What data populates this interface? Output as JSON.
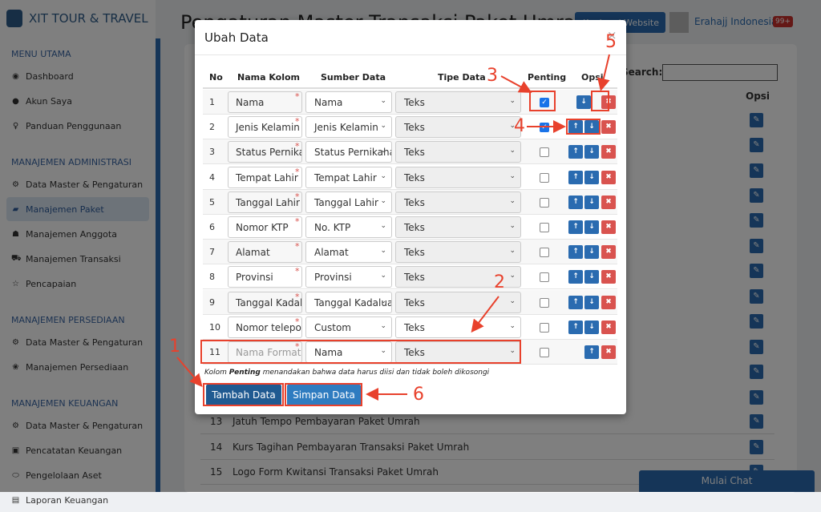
{
  "app": {
    "brand": "XIT TOUR & TRAVEL",
    "page_title": "Pengaturan Master Transaksi Paket Umrah",
    "website_button": "Kunjungi Website",
    "user_name": "Erahajj Indonesia",
    "notif_badge": "99+"
  },
  "sidebar": {
    "sections": [
      {
        "title": "MENU UTAMA",
        "items": [
          {
            "label": "Dashboard",
            "icon": "globe-icon"
          },
          {
            "label": "Akun Saya",
            "icon": "user-icon"
          },
          {
            "label": "Panduan Penggunaan",
            "icon": "lightbulb-icon"
          }
        ]
      },
      {
        "title": "MANAJEMEN ADMINISTRASI",
        "items": [
          {
            "label": "Data Master & Pengaturan",
            "icon": "cogs-icon"
          },
          {
            "label": "Manajemen Paket",
            "icon": "book-icon",
            "active": true
          },
          {
            "label": "Manajemen Anggota",
            "icon": "users-icon"
          },
          {
            "label": "Manajemen Transaksi",
            "icon": "cart-icon"
          },
          {
            "label": "Pencapaian",
            "icon": "star-icon"
          }
        ]
      },
      {
        "title": "MANAJEMEN PERSEDIAAN",
        "items": [
          {
            "label": "Data Master & Pengaturan",
            "icon": "cogs-icon"
          },
          {
            "label": "Manajemen Persediaan",
            "icon": "cubes-icon"
          }
        ]
      },
      {
        "title": "MANAJEMEN KEUANGAN",
        "items": [
          {
            "label": "Data Master & Pengaturan",
            "icon": "cogs-icon"
          },
          {
            "label": "Pencatatan Keuangan",
            "icon": "money-icon"
          },
          {
            "label": "Pengelolaan Aset",
            "icon": "hdd-icon"
          },
          {
            "label": "Laporan Keuangan",
            "icon": "report-icon"
          }
        ]
      }
    ]
  },
  "background_table": {
    "search_label": "Search:",
    "opsi_header": "Opsi",
    "rows": [
      {
        "no": "13",
        "name": "Jatuh Tempo Pembayaran Paket Umrah"
      },
      {
        "no": "14",
        "name": "Kurs Tagihan Pembayaran Transaksi Paket Umrah"
      },
      {
        "no": "15",
        "name": "Logo Form Kwitansi Transaksi Paket Umrah"
      }
    ]
  },
  "chat_button": "Mulai Chat",
  "modal": {
    "title": "Ubah Data",
    "close": "×",
    "headers": {
      "no": "No",
      "nama_kolom": "Nama Kolom",
      "sumber_data": "Sumber Data",
      "tipe_data": "Tipe Data",
      "penting": "Penting",
      "opsi": "Opsi"
    },
    "rows": [
      {
        "no": "1",
        "nama": "Nama",
        "sumber": "Nama",
        "tipe": "Teks",
        "penting": true
      },
      {
        "no": "2",
        "nama": "Jenis Kelamin",
        "sumber": "Jenis Kelamin",
        "tipe": "Teks",
        "penting": true
      },
      {
        "no": "3",
        "nama": "Status Pernikahan",
        "sumber": "Status Pernikahan",
        "tipe": "Teks",
        "penting": false
      },
      {
        "no": "4",
        "nama": "Tempat Lahir",
        "sumber": "Tempat Lahir",
        "tipe": "Teks",
        "penting": false
      },
      {
        "no": "5",
        "nama": "Tanggal Lahir",
        "sumber": "Tanggal Lahir",
        "tipe": "Teks",
        "penting": false
      },
      {
        "no": "6",
        "nama": "Nomor KTP",
        "sumber": "No. KTP",
        "tipe": "Teks",
        "penting": false
      },
      {
        "no": "7",
        "nama": "Alamat",
        "sumber": "Alamat",
        "tipe": "Teks",
        "penting": false
      },
      {
        "no": "8",
        "nama": "Provinsi",
        "sumber": "Provinsi",
        "tipe": "Teks",
        "penting": false
      },
      {
        "no": "9",
        "nama": "Tanggal Kadaluarsa",
        "sumber": "Tanggal Kadaluarsa",
        "tipe": "Teks",
        "penting": false
      },
      {
        "no": "10",
        "nama": "Nomor telepon",
        "sumber": "Custom",
        "tipe": "Teks",
        "penting": false
      },
      {
        "no": "11",
        "nama": "",
        "placeholder": "Nama Format",
        "sumber": "Nama",
        "tipe": "Teks",
        "penting": false
      }
    ],
    "note_prefix": "Kolom ",
    "note_bold": "Penting",
    "note_suffix": " menandakan bahwa data harus diisi dan tidak boleh dikosongi",
    "add_button": "Tambah Data",
    "save_button": "Simpan Data"
  },
  "annotations": {
    "labels": [
      "1",
      "2",
      "3",
      "4",
      "5",
      "6"
    ],
    "color": "#e8412c"
  }
}
